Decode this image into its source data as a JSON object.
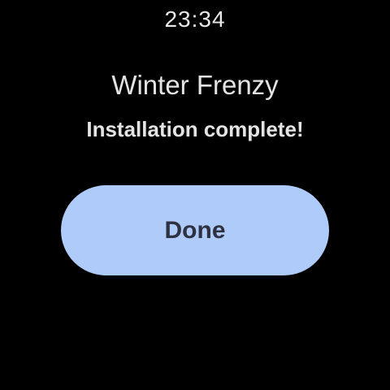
{
  "status_bar": {
    "time": "23:34"
  },
  "dialog": {
    "app_name": "Winter Frenzy",
    "message": "Installation complete!",
    "done_label": "Done"
  },
  "colors": {
    "background": "#000000",
    "button": "#aecbfa",
    "button_text": "#2d3142",
    "text": "#e4e4e4"
  }
}
